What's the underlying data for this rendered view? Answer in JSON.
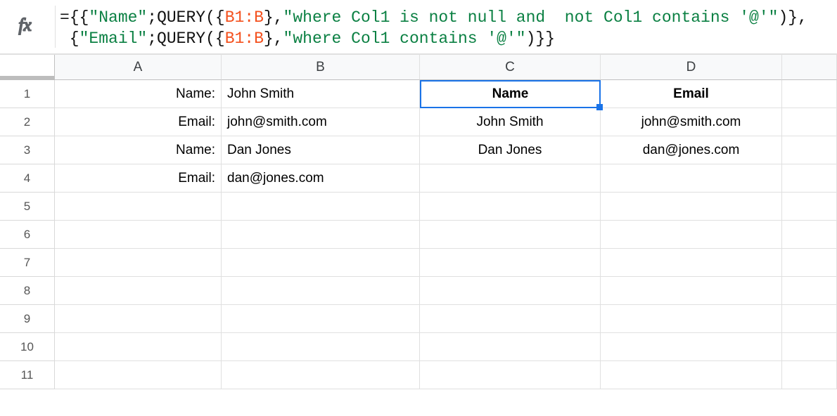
{
  "formula_bar": {
    "line1_segments": [
      {
        "t": "=",
        "c": "black"
      },
      {
        "t": "{{",
        "c": "black"
      },
      {
        "t": "\"Name\"",
        "c": "green"
      },
      {
        "t": ";",
        "c": "black"
      },
      {
        "t": "QUERY",
        "c": "black"
      },
      {
        "t": "(",
        "c": "black"
      },
      {
        "t": "{",
        "c": "black"
      },
      {
        "t": "B1:B",
        "c": "orange"
      },
      {
        "t": "}",
        "c": "black"
      },
      {
        "t": ",",
        "c": "black"
      },
      {
        "t": "\"where Col1 is not null and  not Col1 contains '@'\"",
        "c": "green"
      },
      {
        "t": ")",
        "c": "black"
      },
      {
        "t": "}",
        "c": "black"
      },
      {
        "t": ",",
        "c": "black"
      }
    ],
    "line2_segments": [
      {
        "t": " {",
        "c": "black"
      },
      {
        "t": "\"Email\"",
        "c": "green"
      },
      {
        "t": ";",
        "c": "black"
      },
      {
        "t": "QUERY",
        "c": "black"
      },
      {
        "t": "(",
        "c": "black"
      },
      {
        "t": "{",
        "c": "black"
      },
      {
        "t": "B1:B",
        "c": "orange"
      },
      {
        "t": "}",
        "c": "black"
      },
      {
        "t": ",",
        "c": "black"
      },
      {
        "t": "\"where Col1 contains '@'\"",
        "c": "green"
      },
      {
        "t": ")",
        "c": "black"
      },
      {
        "t": "}}",
        "c": "black"
      }
    ]
  },
  "columns": [
    "A",
    "B",
    "C",
    "D",
    ""
  ],
  "row_numbers": [
    "1",
    "2",
    "3",
    "4",
    "5",
    "6",
    "7",
    "8",
    "9",
    "10",
    "11"
  ],
  "selected_cell": "C1",
  "cells": {
    "A1": "Name:",
    "B1": "John Smith",
    "C1": "Name",
    "D1": "Email",
    "A2": "Email:",
    "B2": "john@smith.com",
    "C2": "John Smith",
    "D2": "john@smith.com",
    "A3": "Name:",
    "B3": "Dan Jones",
    "C3": "Dan Jones",
    "D3": "dan@jones.com",
    "A4": "Email:",
    "B4": "dan@jones.com",
    "C4": "",
    "D4": "",
    "A5": "",
    "B5": "",
    "C5": "",
    "D5": "",
    "A6": "",
    "B6": "",
    "C6": "",
    "D6": "",
    "A7": "",
    "B7": "",
    "C7": "",
    "D7": "",
    "A8": "",
    "B8": "",
    "C8": "",
    "D8": "",
    "A9": "",
    "B9": "",
    "C9": "",
    "D9": "",
    "A10": "",
    "B10": "",
    "C10": "",
    "D10": "",
    "A11": "",
    "B11": "",
    "C11": "",
    "D11": ""
  }
}
